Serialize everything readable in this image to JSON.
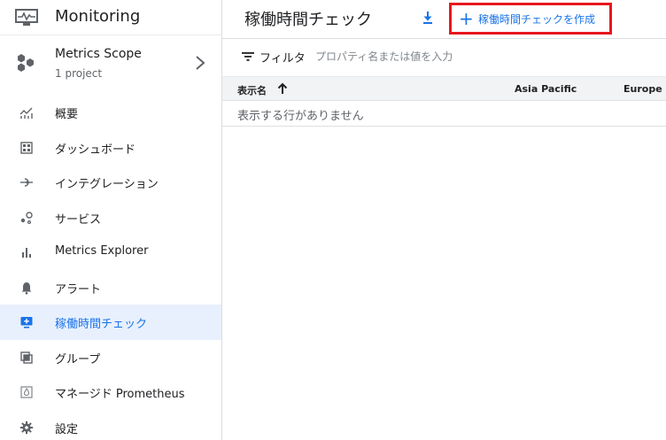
{
  "app": {
    "title": "Monitoring",
    "logo_icon": "monitoring-logo-icon"
  },
  "scope": {
    "title": "Metrics Scope",
    "subtitle": "1 project",
    "icon": "metrics-scope-icon"
  },
  "nav": {
    "items": [
      {
        "label": "概要",
        "icon": "overview-chart-icon",
        "active": false
      },
      {
        "label": "ダッシュボード",
        "icon": "dashboard-icon",
        "active": false
      },
      {
        "label": "インテグレーション",
        "icon": "integration-icon",
        "active": false
      },
      {
        "label": "サービス",
        "icon": "services-icon",
        "active": false
      },
      {
        "label": "Metrics Explorer",
        "icon": "bar-chart-icon",
        "active": false
      },
      {
        "label": "アラート",
        "icon": "bell-icon",
        "active": false
      },
      {
        "label": "稼働時間チェック",
        "icon": "uptime-monitor-icon",
        "active": true
      },
      {
        "label": "グループ",
        "icon": "groups-icon",
        "active": false
      },
      {
        "label": "マネージド Prometheus",
        "icon": "prometheus-icon",
        "active": false
      },
      {
        "label": "設定",
        "icon": "gear-icon",
        "active": false
      }
    ]
  },
  "main": {
    "title": "稼働時間チェック",
    "download_icon": "download-icon",
    "create_button": {
      "label": "稼働時間チェックを作成",
      "icon": "plus-icon"
    }
  },
  "filter": {
    "label": "フィルタ",
    "placeholder": "プロパティ名または値を入力",
    "icon": "filter-icon"
  },
  "table": {
    "columns": [
      "表示名",
      "Asia Pacific",
      "Europe"
    ],
    "sort_icon": "arrow-up-icon",
    "empty_message": "表示する行がありません"
  },
  "colors": {
    "accent": "#1a73e8",
    "active_bg": "#e8f0fe",
    "highlight_border": "#e8171e"
  }
}
